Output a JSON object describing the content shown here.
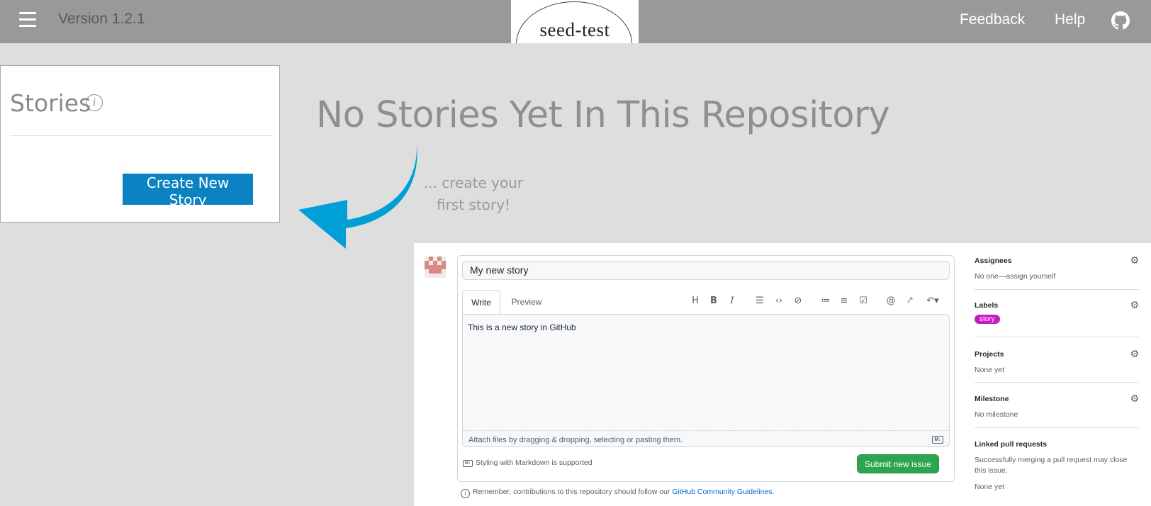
{
  "header": {
    "version": "Version 1.2.1",
    "logo_text": "seed-test",
    "feedback": "Feedback",
    "help": "Help",
    "icons": {
      "menu": "hamburger-menu-icon",
      "github": "github-icon"
    }
  },
  "stories": {
    "title": "Stories",
    "info_icon_glyph": "i",
    "create_button": "Create New Story"
  },
  "empty_state": {
    "heading": "No Stories Yet In This Repository",
    "sub_line1": "... create your",
    "sub_line2": "first story!",
    "arrow_color": "#00a0d6"
  },
  "github_issue": {
    "title_value": "My new story",
    "tabs": {
      "write": "Write",
      "preview": "Preview"
    },
    "body_text": "This is a new story in GitHub",
    "attach_text": "Attach files by dragging & dropping, selecting or pasting them.",
    "markdown_note": "Styling with Markdown is supported",
    "submit_button": "Submit new issue",
    "remember_prefix": "Remember, contributions to this repository should follow our ",
    "remember_link": "GitHub Community Guidelines",
    "remember_suffix": ".",
    "toolbar": [
      "H",
      "B",
      "I",
      "quote",
      "code",
      "link",
      "bullet-list",
      "numbered-list",
      "task-list",
      "mention",
      "reference",
      "reply"
    ],
    "sidebar": {
      "assignees": {
        "label": "Assignees",
        "value": "No one—assign yourself"
      },
      "labels": {
        "label": "Labels",
        "tag": "story",
        "tag_color": "#c41bc7"
      },
      "projects": {
        "label": "Projects",
        "value": "None yet"
      },
      "milestone": {
        "label": "Milestone",
        "value": "No milestone"
      },
      "linked_prs": {
        "label": "Linked pull requests",
        "value": "Successfully merging a pull request may close this issue.",
        "value2": "None yet"
      }
    },
    "submit_color": "#2da44e"
  },
  "colors": {
    "topbar": "#999999",
    "background": "#dedede",
    "create_button": "#0b83c2"
  }
}
